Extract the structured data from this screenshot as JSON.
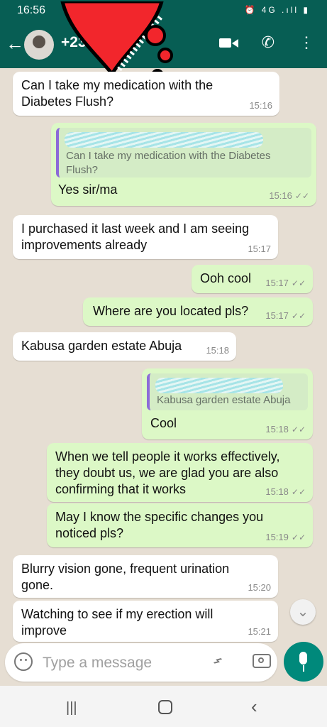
{
  "status_bar": {
    "time": "16:56",
    "icons": "⏰ 4G .ıll ▮"
  },
  "header": {
    "contact_name": "+23 3 7878",
    "icons": [
      "back-arrow-icon",
      "avatar",
      "video-call-icon",
      "voice-call-icon",
      "more-options-icon"
    ]
  },
  "chat": {
    "messages": [
      {
        "direction": "incoming",
        "text": "Can I take my medication with the Diabetes Flush?",
        "time": "15:16"
      },
      {
        "direction": "outgoing",
        "quoted": "Can I take my medication with the Diabetes Flush?",
        "text": "Yes sir/ma",
        "time": "15:16",
        "status": "read"
      },
      {
        "direction": "incoming",
        "text": "I purchased it last week and I am seeing improvements already",
        "time": "15:17"
      },
      {
        "direction": "outgoing",
        "text": "Ooh cool",
        "time": "15:17",
        "status": "read"
      },
      {
        "direction": "outgoing",
        "text": "Where are you located pls?",
        "time": "15:17",
        "status": "read"
      },
      {
        "direction": "incoming",
        "text": "Kabusa garden estate Abuja",
        "time": "15:18"
      },
      {
        "direction": "outgoing",
        "quoted": "Kabusa garden estate Abuja",
        "text": "Cool",
        "time": "15:18",
        "status": "read"
      },
      {
        "direction": "outgoing",
        "text": "When we tell people it works effectively, they doubt us, we are glad you are also confirming that it works",
        "time": "15:18",
        "status": "read"
      },
      {
        "direction": "outgoing",
        "text": "May I know the specific changes you noticed pls?",
        "time": "15:19",
        "status": "read"
      },
      {
        "direction": "incoming",
        "text": "Blurry vision gone, frequent urination gone.",
        "time": "15:20"
      },
      {
        "direction": "incoming",
        "text": "Watching to see if my erection will improve",
        "time": "15:21"
      }
    ],
    "read_ticks": "✓✓"
  },
  "composer": {
    "placeholder": "Type a message"
  },
  "colors": {
    "header": "#075e54",
    "incoming": "#ffffff",
    "outgoing": "#dcf8c6",
    "accent": "#00897b",
    "heart": "#f2262c"
  }
}
